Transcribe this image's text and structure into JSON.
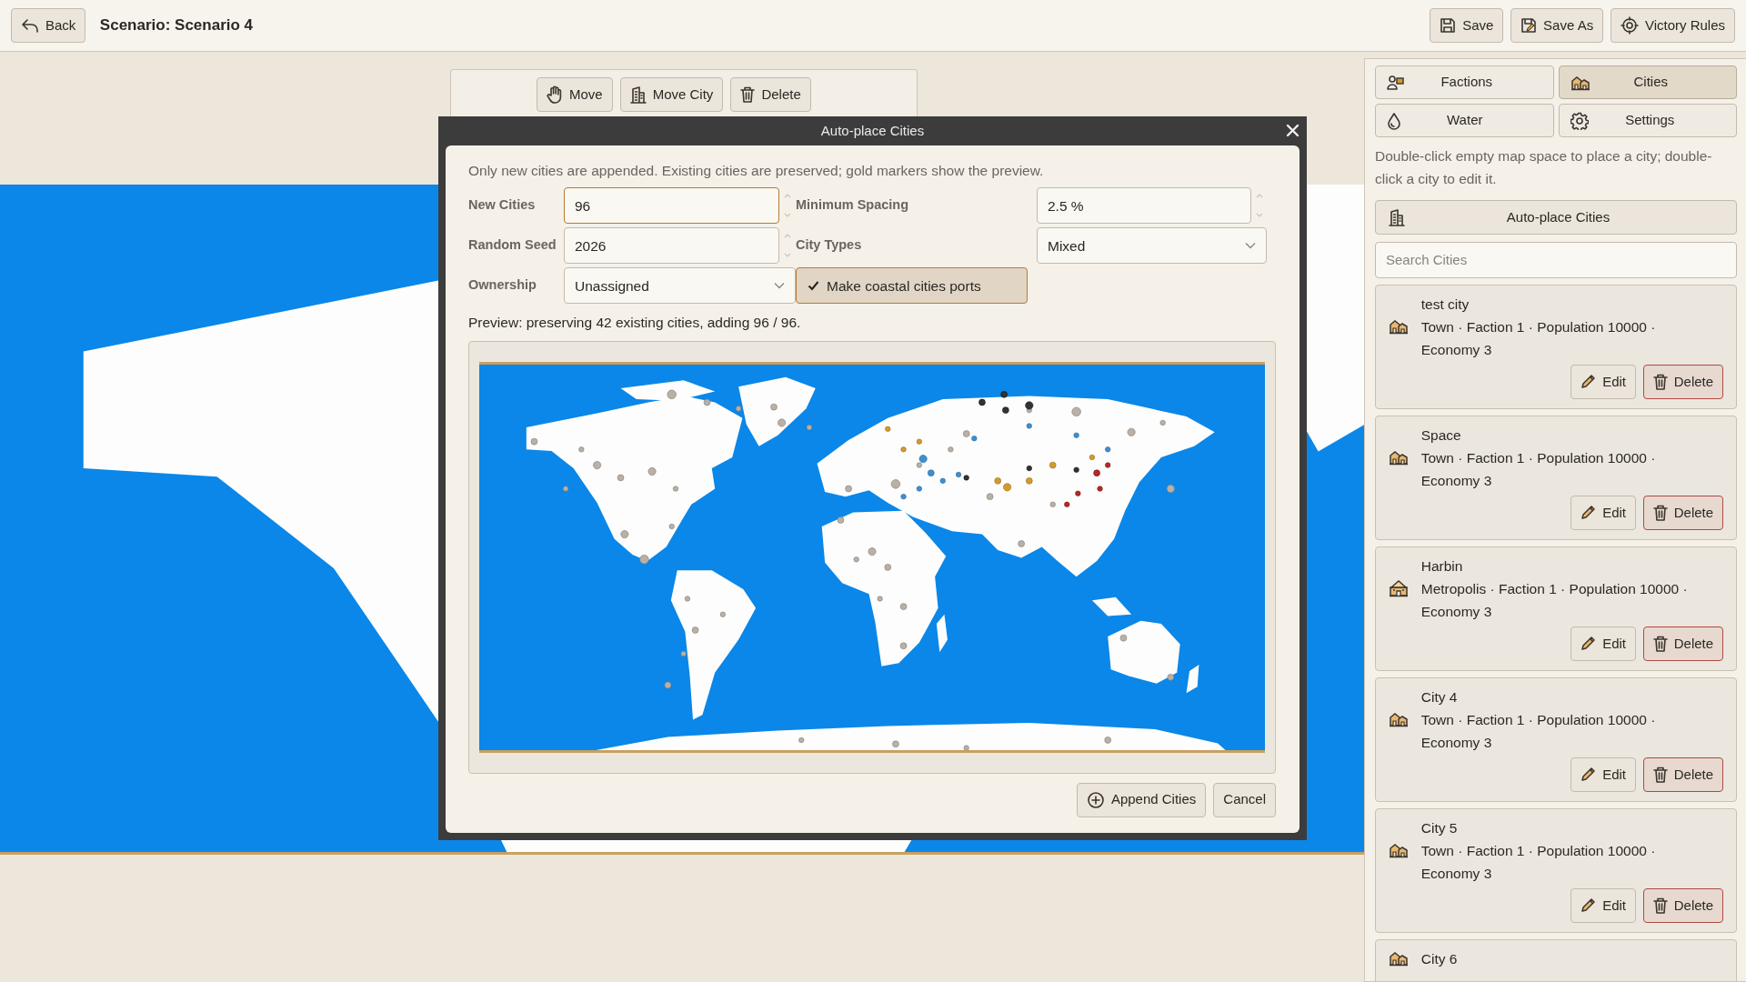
{
  "top_bar": {
    "back": "Back",
    "title": "Scenario: Scenario 4",
    "actions": [
      "Save",
      "Save As",
      "Victory Rules"
    ]
  },
  "map_toolbar": [
    "Move",
    "Move City",
    "Delete"
  ],
  "dialog": {
    "title": "Auto-place Cities",
    "note": "Only new cities are appended. Existing cities are preserved; gold markers show the preview.",
    "fields": [
      {
        "label": "New Cities",
        "value": "96",
        "kind": "number",
        "focused": true
      },
      {
        "label": "Minimum Spacing",
        "value": "2.5 %",
        "kind": "number",
        "focused": false
      },
      {
        "label": "Random Seed",
        "value": "2026",
        "kind": "number",
        "focused": false
      },
      {
        "label": "City Types",
        "value": "Mixed",
        "kind": "select",
        "focused": false
      },
      {
        "label": "Ownership",
        "value": "Unassigned",
        "kind": "select",
        "focused": false
      }
    ],
    "checkbox": {
      "label": "Make coastal cities ports",
      "checked": true
    },
    "preview": "Preview: preserving 42 existing cities, adding 96 / 96.",
    "buttons": [
      "Append Cities",
      "Cancel"
    ]
  },
  "sidebar": {
    "tabs": [
      {
        "label": "Factions",
        "selected": false
      },
      {
        "label": "Cities",
        "selected": true
      },
      {
        "label": "Water",
        "selected": false
      },
      {
        "label": "Settings",
        "selected": false
      }
    ],
    "hint": "Double-click empty map space to place a city; double-click a city to edit it.",
    "auto_place": "Auto-place Cities",
    "search": {
      "placeholder": "Search Cities"
    },
    "cities": [
      {
        "name": "test city",
        "kind": "town",
        "details": "Town · Faction 1 · Population 10000 · Economy 3",
        "edit": "Edit",
        "delete": "Delete"
      },
      {
        "name": "Space",
        "kind": "town",
        "details": "Town · Faction 1 · Population 10000 · Economy 3",
        "edit": "Edit",
        "delete": "Delete"
      },
      {
        "name": "Harbin",
        "kind": "metropolis",
        "details": "Metropolis · Faction 1 · Population 10000 · Economy 3",
        "edit": "Edit",
        "delete": "Delete"
      },
      {
        "name": "City 4",
        "kind": "town",
        "details": "Town · Faction 1 · Population 10000 · Economy 3",
        "edit": "Edit",
        "delete": "Delete"
      },
      {
        "name": "City 5",
        "kind": "town",
        "details": "Town · Faction 1 · Population 10000 · Economy 3",
        "edit": "Edit",
        "delete": "Delete"
      },
      {
        "name": "City 6",
        "kind": "town"
      }
    ]
  }
}
